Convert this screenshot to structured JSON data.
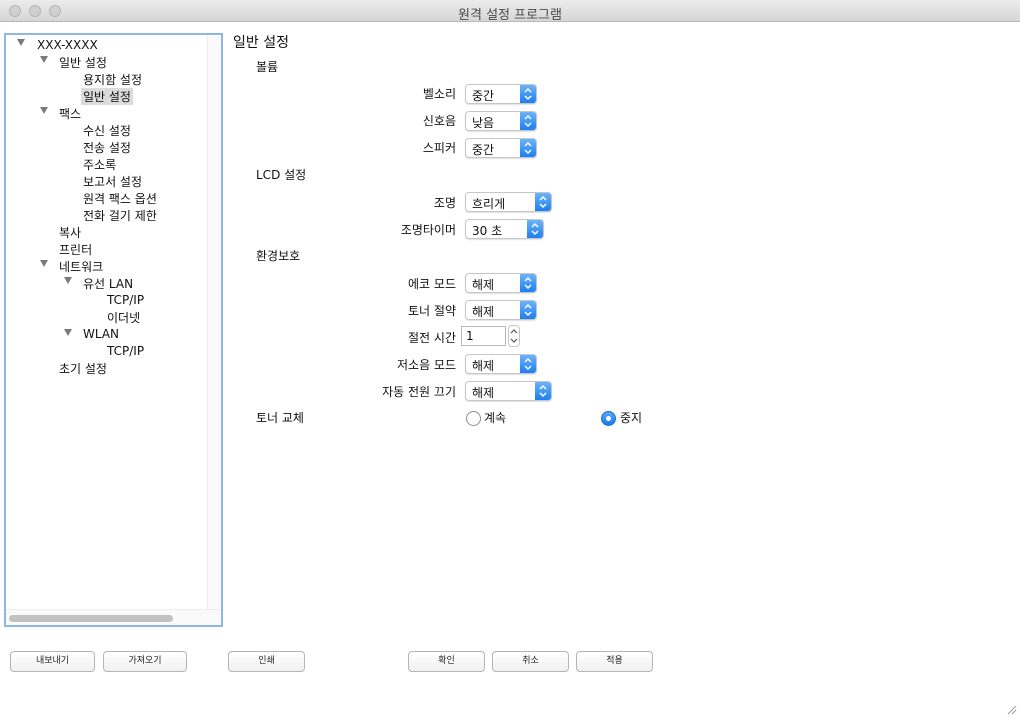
{
  "window": {
    "title": "원격 설정 프로그램"
  },
  "tree": {
    "root": "XXX-XXXX",
    "general": "일반 설정",
    "paper": "용지함 설정",
    "general_child": "일반 설정",
    "fax": "팩스",
    "fax_items": [
      "수신 설정",
      "전송 설정",
      "주소록",
      "보고서 설정",
      "원격 팩스 옵션",
      "전화 걸기 제한"
    ],
    "copy": "복사",
    "printer": "프린터",
    "network": "네트워크",
    "wired_lan": "유선 LAN",
    "wired_tcpip": "TCP/IP",
    "ethernet": "이더넷",
    "wlan": "WLAN",
    "wlan_tcpip": "TCP/IP",
    "reset": "초기 설정"
  },
  "main": {
    "heading": "일반 설정",
    "volume": {
      "section": "볼륨",
      "ring": {
        "label": "벨소리",
        "value": "중간"
      },
      "beep": {
        "label": "신호음",
        "value": "낮음"
      },
      "speaker": {
        "label": "스피커",
        "value": "중간"
      }
    },
    "lcd": {
      "section": "LCD 설정",
      "backlight": {
        "label": "조명",
        "value": "흐리게"
      },
      "dim_timer": {
        "label": "조명타이머",
        "value": "30 초"
      }
    },
    "eco": {
      "section": "환경보호",
      "eco_mode": {
        "label": "에코 모드",
        "value": "해제"
      },
      "toner_save": {
        "label": "토너 절약",
        "value": "해제"
      },
      "sleep_time": {
        "label": "절전 시간",
        "value": "1"
      },
      "quiet_mode": {
        "label": "저소음 모드",
        "value": "해제"
      },
      "auto_off": {
        "label": "자동 전원 끄기",
        "value": "해제"
      }
    },
    "toner_replace": {
      "section": "토너 교체",
      "continue": "계속",
      "stop": "중지",
      "selected": "stop"
    }
  },
  "buttons": {
    "export": "내보내기",
    "import": "가져오기",
    "print": "인쇄",
    "ok": "확인",
    "cancel": "취소",
    "apply": "적용"
  }
}
